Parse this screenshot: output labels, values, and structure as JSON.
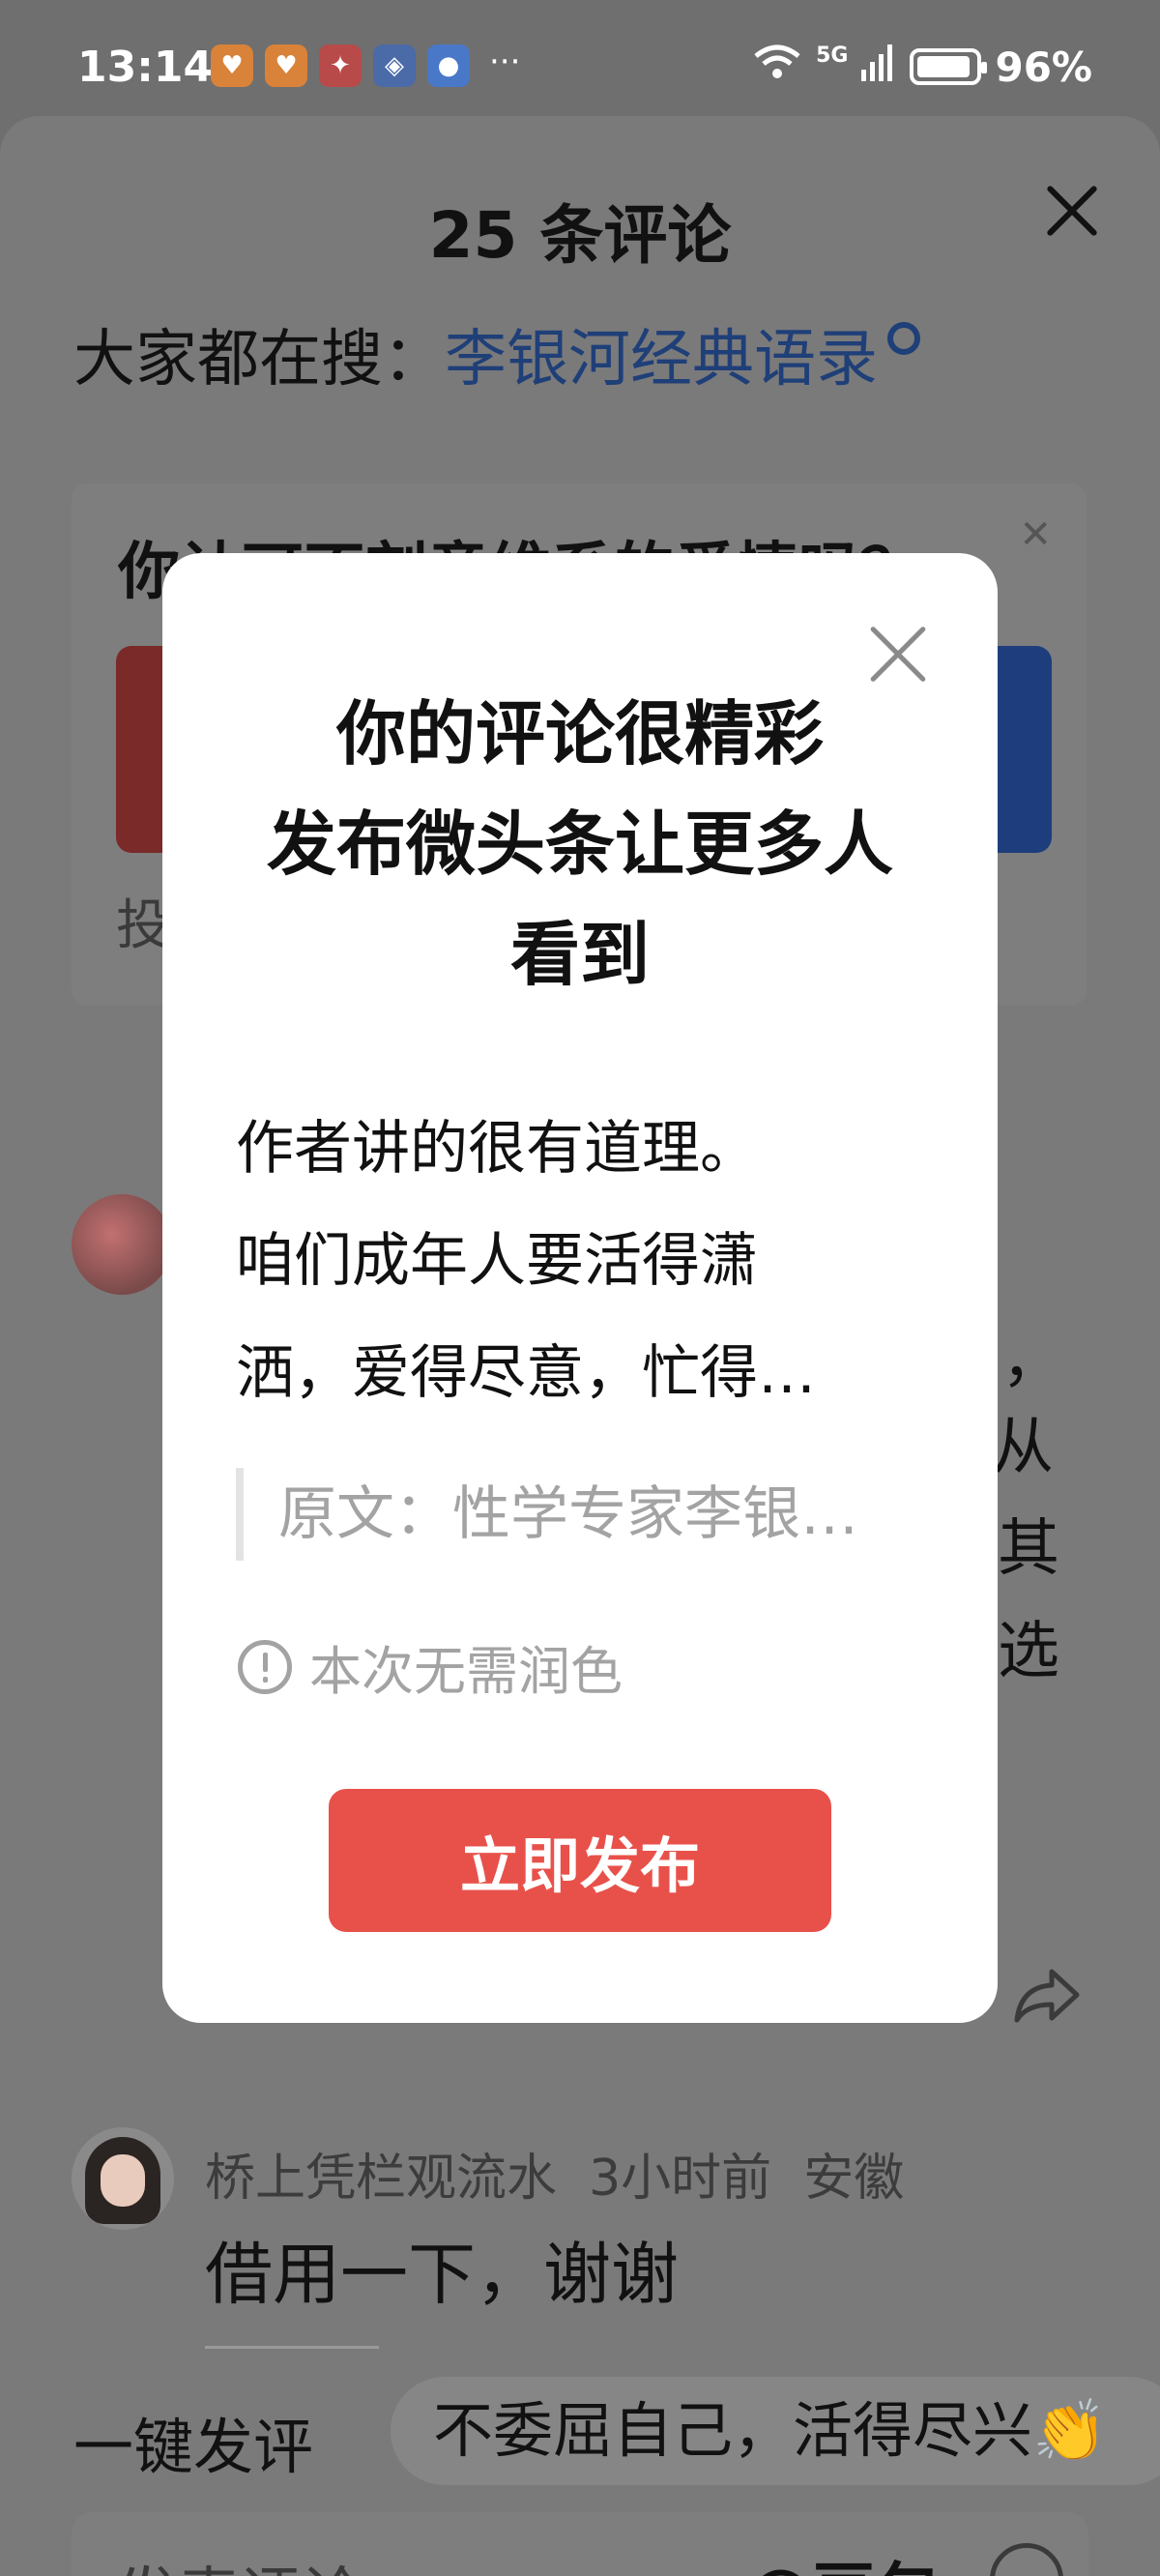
{
  "status_bar": {
    "time": "13:14",
    "network": "5G",
    "battery": "96%",
    "more": "···",
    "app_icons": [
      "heart-app-icon",
      "heart-app-icon",
      "game-app-icon",
      "compass-app-icon",
      "message-app-icon"
    ]
  },
  "sheet": {
    "title": "25 条评论",
    "search_prefix": "大家都在搜：",
    "search_keyword": "李银河经典语录",
    "card_question": "你认可不刻意维系的爱情吗？",
    "card_footer": "投",
    "comment1_partial": [
      "，",
      "从",
      "其",
      "选"
    ],
    "comment2": {
      "user": "桥上凭栏观流水",
      "time": "3小时前",
      "location": "安徽",
      "text": "借用一下，谢谢"
    },
    "quick_comment_label": "一键发评",
    "quick_comment_chip": "不委屈自己，活得尽兴👏",
    "input_placeholder": "发表评论",
    "at_doubao": "@豆包"
  },
  "modal": {
    "title_lines": [
      "你的评论很精彩",
      "发布微头条让更多人",
      "看到"
    ],
    "comment_lines": [
      "作者讲的很有道理。",
      "咱们成年人要活得潇",
      "洒，爱得尽意，忙得…"
    ],
    "quote": "原文：性学专家李银…",
    "info": "本次无需润色",
    "publish_label": "立即发布"
  },
  "colors": {
    "accent_red": "#e8514a",
    "link_blue": "#1f3f78",
    "overlay": "#6f6f6f"
  }
}
